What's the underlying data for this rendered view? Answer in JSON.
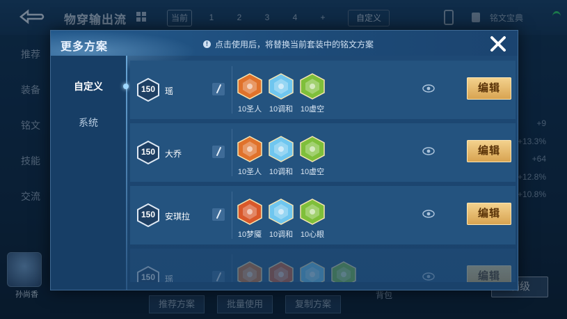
{
  "background": {
    "title": "物穿输出流",
    "tabs": [
      "当前",
      "1",
      "2",
      "3",
      "4",
      "+"
    ],
    "custom_label": "自定义",
    "book_label": "铭文宝典",
    "side_items": [
      "推荐",
      "装备",
      "铭文",
      "技能",
      "交流"
    ],
    "right_values": [
      "+9",
      "+13.3%",
      "+64",
      "+12.8%",
      "+10.8%"
    ],
    "player_name": "孙尚香",
    "bottom_buttons": [
      "推荐方案",
      "批量使用",
      "复制方案"
    ],
    "bag_label": "背包",
    "level_button": "满级"
  },
  "modal": {
    "title": "更多方案",
    "notice": "点击使用后，将替换当前套装中的铭文方案",
    "tabs": [
      {
        "label": "自定义",
        "active": true
      },
      {
        "label": "系统",
        "active": false
      }
    ],
    "edit_label": "编辑",
    "rows": [
      {
        "level": "150",
        "hero": "瑶",
        "gems": [
          {
            "label": "10圣人",
            "icon": "orange-crystal-gem-icon",
            "color": "#e0722b"
          },
          {
            "label": "10调和",
            "icon": "blue-drop-gem-icon",
            "color": "#6fc6ef"
          },
          {
            "label": "10虚空",
            "icon": "green-gem-icon",
            "color": "#7fbf3a"
          }
        ]
      },
      {
        "level": "150",
        "hero": "大乔",
        "gems": [
          {
            "label": "10圣人",
            "icon": "orange-crystal-gem-icon",
            "color": "#e0722b"
          },
          {
            "label": "10调和",
            "icon": "blue-drop-gem-icon",
            "color": "#6fc6ef"
          },
          {
            "label": "10虚空",
            "icon": "green-gem-icon",
            "color": "#7fbf3a"
          }
        ]
      },
      {
        "level": "150",
        "hero": "安琪拉",
        "gems": [
          {
            "label": "10梦魇",
            "icon": "orange-flame-gem-icon",
            "color": "#d9582a"
          },
          {
            "label": "10调和",
            "icon": "blue-drop-gem-icon",
            "color": "#6fc6ef"
          },
          {
            "label": "10心眼",
            "icon": "green-gem-icon",
            "color": "#7fbf3a"
          }
        ]
      },
      {
        "level": "150",
        "hero": "瑶",
        "gems": [
          {
            "label": "",
            "icon": "orange-gem-icon",
            "color": "#e0722b"
          },
          {
            "label": "",
            "icon": "orange-gem-icon",
            "color": "#d9582a"
          },
          {
            "label": "",
            "icon": "teal-gem-icon",
            "color": "#6fc6ef"
          },
          {
            "label": "",
            "icon": "green-gem-icon",
            "color": "#7fbf3a"
          }
        ]
      }
    ]
  }
}
